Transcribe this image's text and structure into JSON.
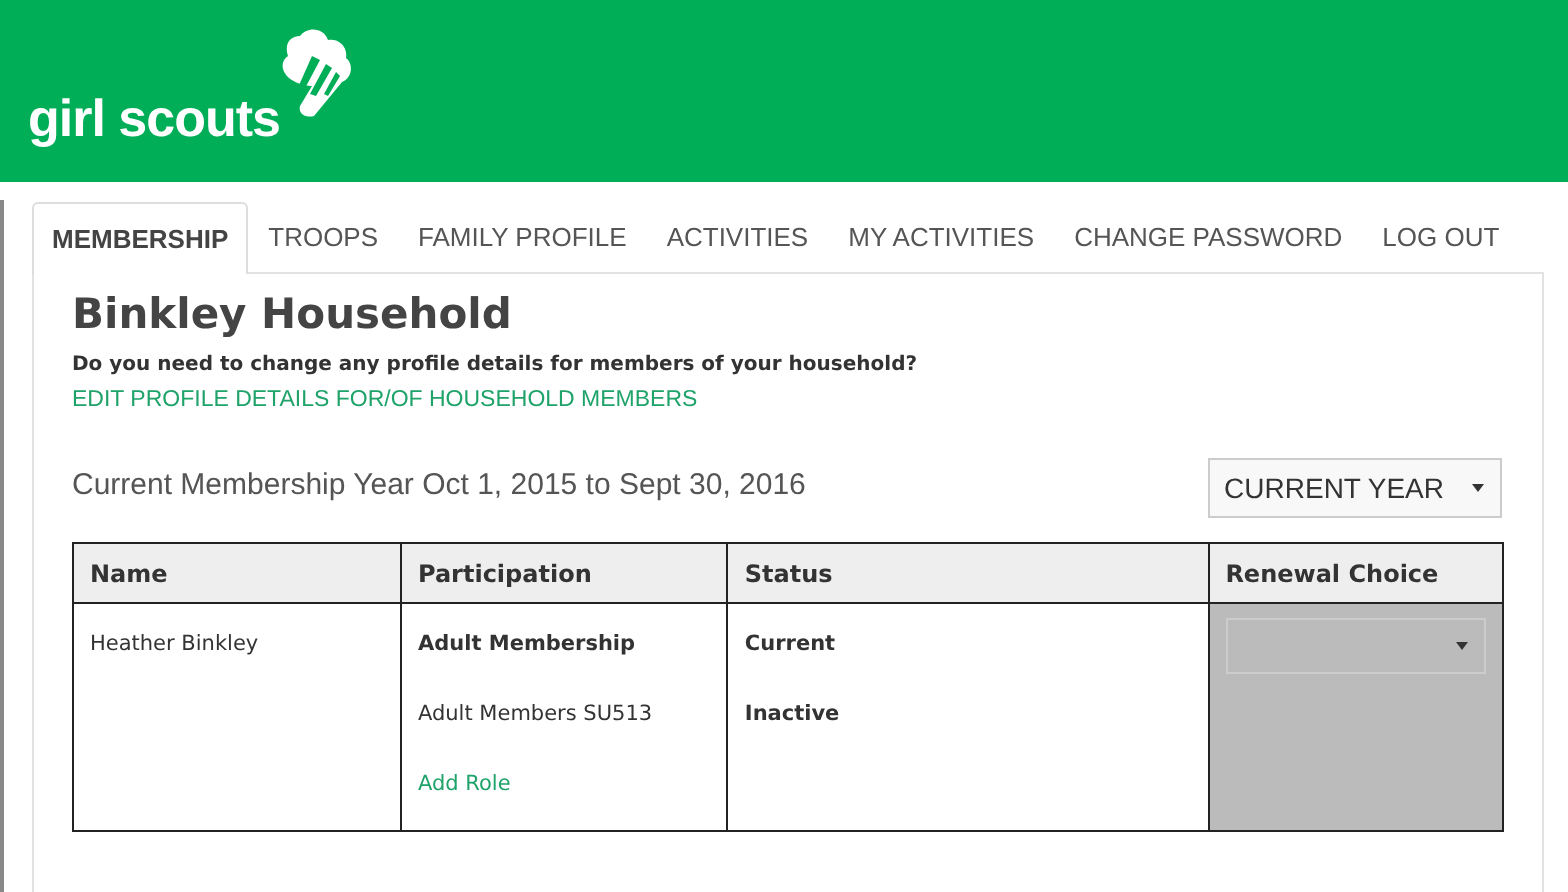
{
  "header": {
    "logo_text": "girl scouts"
  },
  "tabs": [
    {
      "label": "MEMBERSHIP",
      "selected": true
    },
    {
      "label": "TROOPS",
      "selected": false
    },
    {
      "label": "FAMILY PROFILE",
      "selected": false
    },
    {
      "label": "ACTIVITIES",
      "selected": false
    },
    {
      "label": "MY ACTIVITIES",
      "selected": false
    },
    {
      "label": "CHANGE PASSWORD",
      "selected": false
    },
    {
      "label": "LOG OUT",
      "selected": false
    }
  ],
  "household": {
    "title": "Binkley Household",
    "question": "Do you need to change any profile details for members of your household?",
    "link": "EDIT PROFILE DETAILS FOR/OF HOUSEHOLD MEMBERS"
  },
  "membership_year": {
    "text": "Current Membership Year Oct 1, 2015 to Sept 30, 2016",
    "year_select": "CURRENT YEAR"
  },
  "table": {
    "columns": [
      "Name",
      "Participation",
      "Status",
      "Renewal Choice"
    ],
    "rows": [
      {
        "name": "Heather Binkley",
        "participation": [
          {
            "text": "Adult Membership",
            "kind": "bold"
          },
          {
            "text": "Adult Members SU513",
            "kind": "plain"
          },
          {
            "text": "Add Role",
            "kind": "link"
          }
        ],
        "status": [
          "Current",
          "Inactive"
        ],
        "renewal_choice": {
          "disabled": true
        }
      }
    ]
  }
}
